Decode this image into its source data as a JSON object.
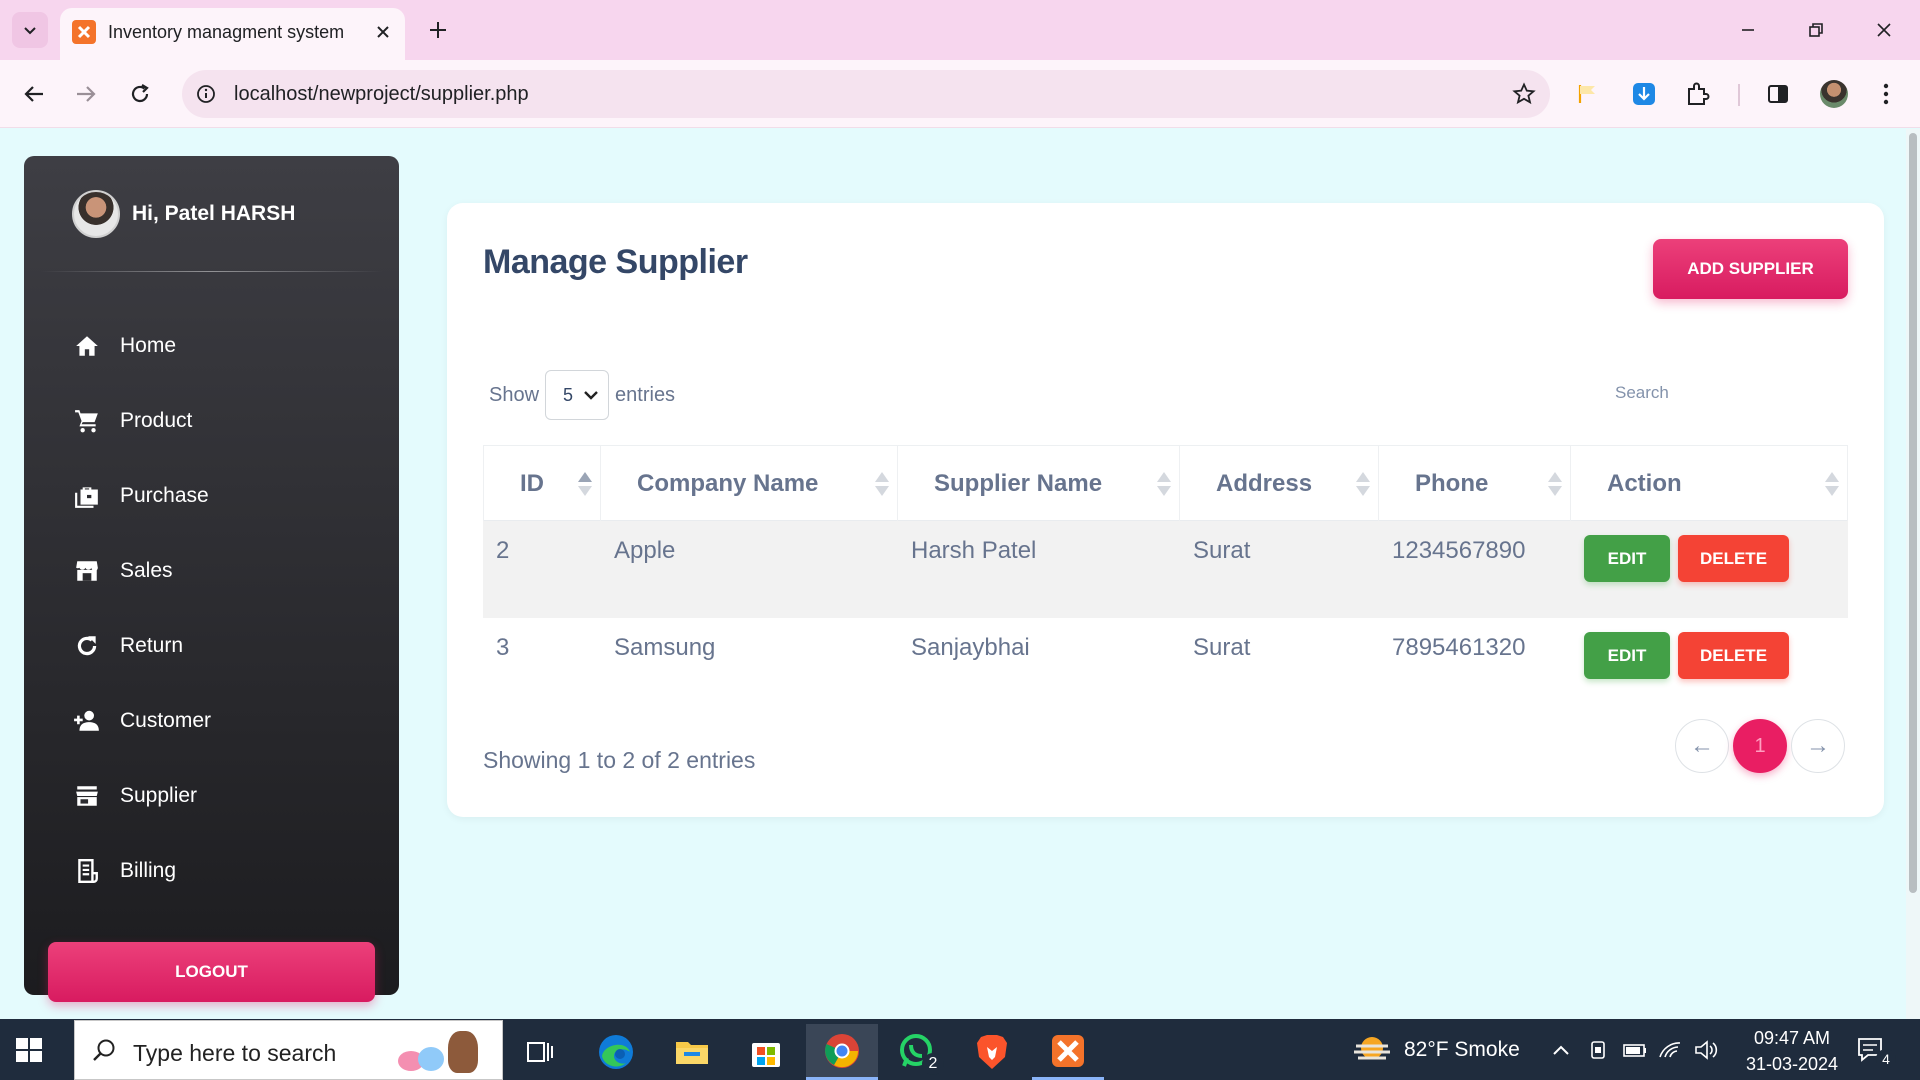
{
  "browser": {
    "tab_title": "Inventory managment system",
    "url": "localhost/newproject/supplier.php"
  },
  "sidebar": {
    "greeting": "Hi, Patel HARSH",
    "items": [
      {
        "label": "Home",
        "icon": "home-icon"
      },
      {
        "label": "Product",
        "icon": "cart-icon"
      },
      {
        "label": "Purchase",
        "icon": "briefcase-icon"
      },
      {
        "label": "Sales",
        "icon": "store-icon"
      },
      {
        "label": "Return",
        "icon": "refresh-icon"
      },
      {
        "label": "Customer",
        "icon": "person-add-icon"
      },
      {
        "label": "Supplier",
        "icon": "storefront-icon"
      },
      {
        "label": "Billing",
        "icon": "receipt-icon"
      }
    ],
    "logout_label": "LOGOUT"
  },
  "main": {
    "title": "Manage Supplier",
    "add_button": "ADD SUPPLIER",
    "show_label": "Show",
    "entries_value": "5",
    "entries_label": "entries",
    "search_placeholder": "Search",
    "columns": [
      "ID",
      "Company Name",
      "Supplier Name",
      "Address",
      "Phone",
      "Action"
    ],
    "rows": [
      {
        "id": "2",
        "company": "Apple",
        "supplier": "Harsh Patel",
        "address": "Surat",
        "phone": "1234567890"
      },
      {
        "id": "3",
        "company": "Samsung",
        "supplier": "Sanjaybhai",
        "address": "Surat",
        "phone": "7895461320"
      }
    ],
    "edit_label": "EDIT",
    "delete_label": "DELETE",
    "info": "Showing 1 to 2 of 2 entries",
    "pagination": {
      "prev": "←",
      "current": "1",
      "next": "→"
    }
  },
  "taskbar": {
    "search_placeholder": "Type here to search",
    "whatsapp_badge": "2",
    "weather": "82°F  Smoke",
    "time": "09:47 AM",
    "date": "31-03-2024",
    "notification_count": "4"
  },
  "colors": {
    "accent": "#e91e63",
    "success": "#43a047",
    "danger": "#f44335",
    "heading": "#344767"
  }
}
